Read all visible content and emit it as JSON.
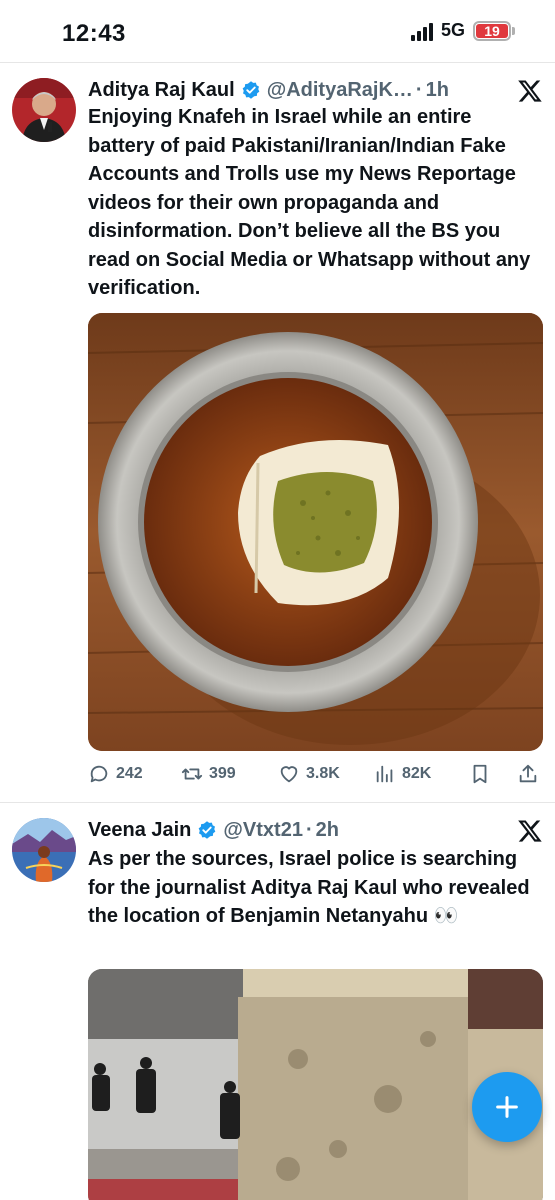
{
  "status_bar": {
    "time": "12:43",
    "network": "5G",
    "battery_level": "19",
    "battery_color": "#e0393e"
  },
  "colors": {
    "accent": "#1d9bf0",
    "text_primary": "#0f1419",
    "text_secondary": "#536471"
  },
  "tweets": [
    {
      "author": "Aditya Raj Kaul",
      "handle": "@AdityaRajK…",
      "separator": "·",
      "time": "1h",
      "verified": true,
      "text": "Enjoying Knafeh in Israel while an entire battery of paid Pakistani/Iranian/Indian Fake Accounts and Trolls use my News Reportage videos for their own propaganda and disinformation. Don’t believe all the BS you read on Social Media or Whatsapp without any verification.",
      "media": "photo of knafeh on a metal plate over a wooden table",
      "actions": {
        "replies": "242",
        "reposts": "399",
        "likes": "3.8K",
        "views": "82K"
      }
    },
    {
      "author": "Veena Jain",
      "handle": "@Vtxt21",
      "separator": "·",
      "time": "2h",
      "verified": true,
      "text": "As per the sources, Israel police is searching for the journalist Aditya Raj Kaul who revealed the location of Benjamin Netanyahu 👀",
      "media": "video still of people near a stone wall"
    }
  ],
  "fab": {
    "icon": "plus-icon"
  }
}
